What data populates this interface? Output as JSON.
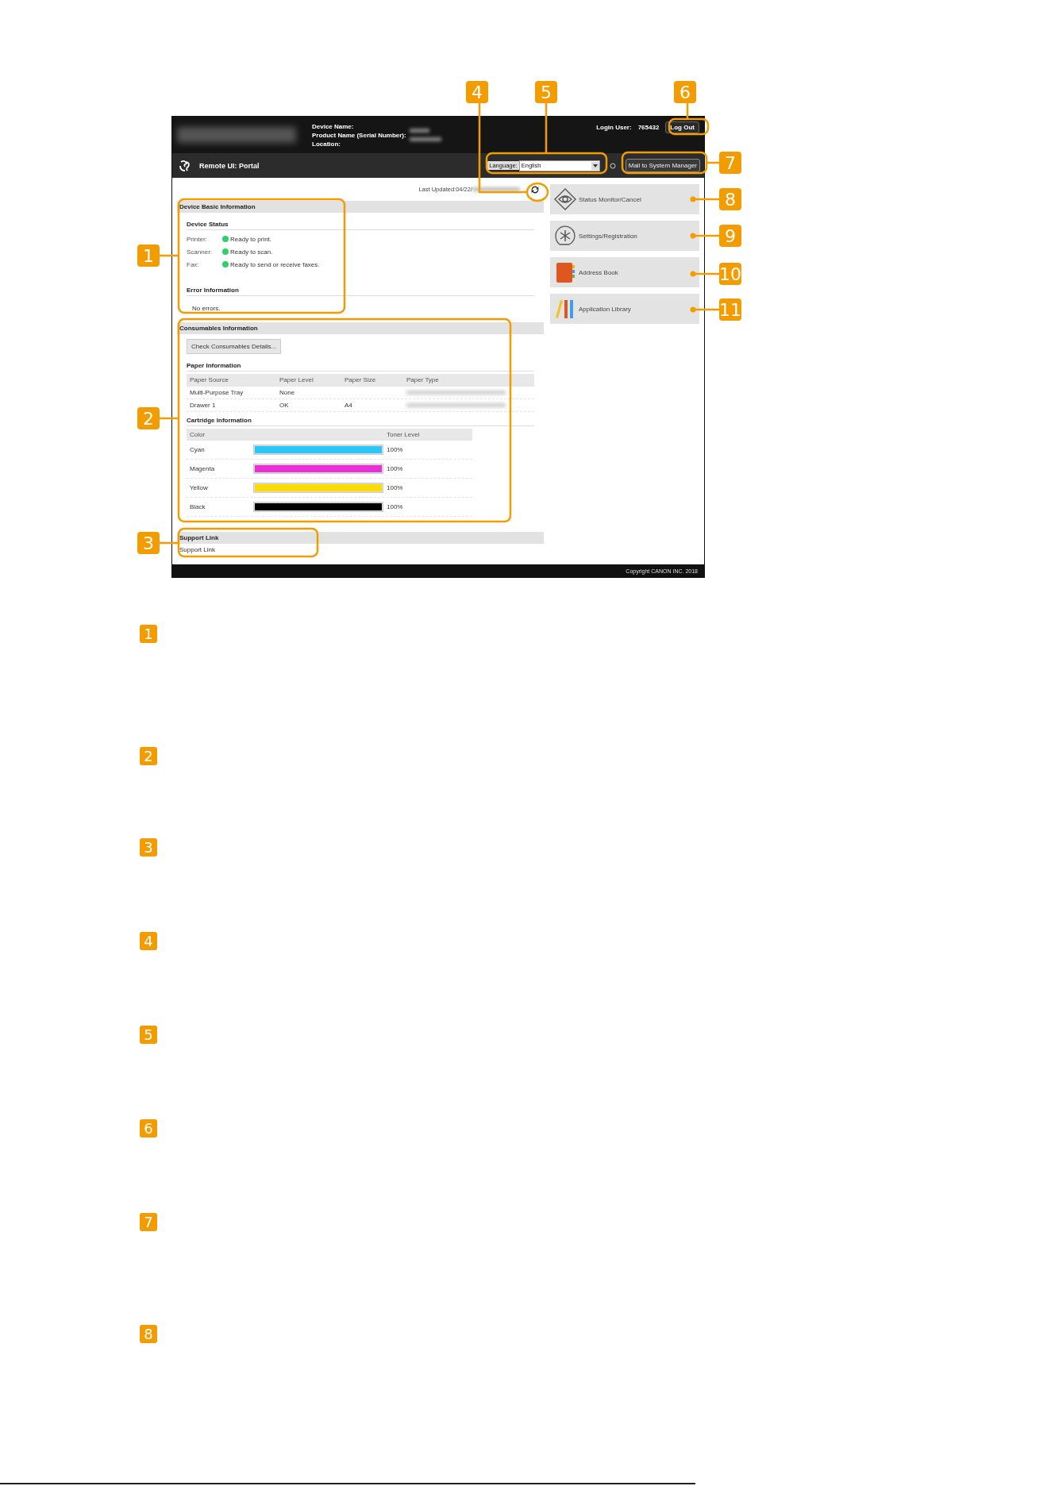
{
  "screenshot": {
    "header": {
      "device_name_label": "Device Name:",
      "product_name_label": "Product Name (Serial Number):",
      "location_label": "Location:",
      "login_user_label": "Login User:",
      "login_user": "765432",
      "logout_button": "Log Out"
    },
    "portal_title": "Remote UI: Portal",
    "language": {
      "label": "Language:",
      "value": "English"
    },
    "mail_button": "Mail to System Manager",
    "last_updated": "Last Updated:04/22/",
    "device_basic_information": {
      "title": "Device Basic Information",
      "status_title": "Device Status",
      "statuses": [
        {
          "label": "Printer:",
          "text": "Ready to print.",
          "color": "#2fcf6a"
        },
        {
          "label": "Scanner:",
          "text": "Ready to scan.",
          "color": "#2fcf6a"
        },
        {
          "label": "Fax:",
          "text": "Ready to send or receive faxes.",
          "color": "#2fcf6a"
        }
      ],
      "error_title": "Error Information",
      "error_text": "No errors."
    },
    "consumables": {
      "title": "Consumables Information",
      "details_button": "Check Consumables Details...",
      "paper_title": "Paper Information",
      "paper_columns": [
        "Paper Source",
        "Paper Level",
        "Paper Size",
        "Paper Type"
      ],
      "paper_rows": [
        [
          "Multi-Purpose Tray",
          "None",
          ""
        ],
        [
          "Drawer 1",
          "OK",
          "A4"
        ]
      ],
      "cartridge_title": "Cartridge Information",
      "cartridge_columns": [
        "Color",
        "Toner Level"
      ],
      "cartridges": [
        {
          "name": "Cyan",
          "color": "#29c6f8",
          "level": 1,
          "reading": "100%"
        },
        {
          "name": "Magenta",
          "color": "#e92fd6",
          "level": 1,
          "reading": "100%"
        },
        {
          "name": "Yellow",
          "color": "#ffdc00",
          "level": 1,
          "reading": "100%"
        },
        {
          "name": "Black",
          "color": "#000000",
          "level": 1,
          "reading": "100%"
        }
      ]
    },
    "support_link": {
      "title": "Support Link",
      "link": "Support Link"
    },
    "menu": [
      {
        "label": "Status Monitor/Cancel",
        "kind": "eye"
      },
      {
        "label": "Settings/Registration",
        "kind": "gear"
      },
      {
        "label": "Address Book",
        "kind": "book"
      },
      {
        "label": "Application Library",
        "kind": "library"
      }
    ],
    "copyright": "Copyright CANON INC. 2018"
  },
  "callouts": [
    "1",
    "2",
    "3",
    "4",
    "5",
    "6",
    "7",
    "8",
    "9",
    "10",
    "11"
  ],
  "legend": [
    "1",
    "2",
    "3",
    "4",
    "5",
    "6",
    "7",
    "8"
  ]
}
